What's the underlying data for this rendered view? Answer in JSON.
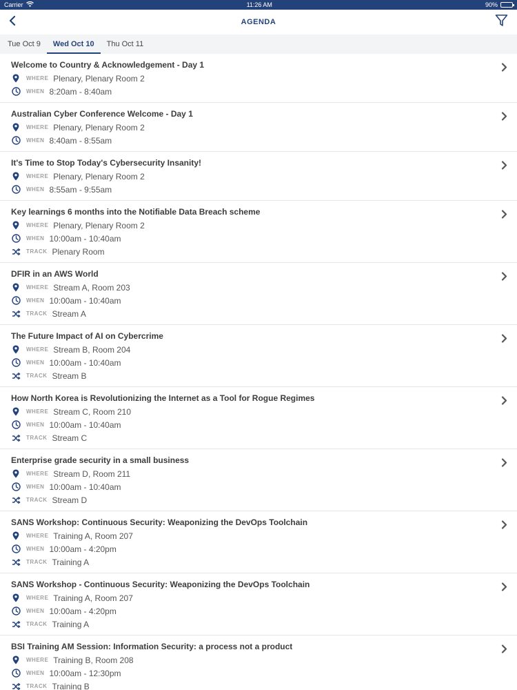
{
  "status_bar": {
    "carrier": "Carrier",
    "time": "11:26 AM",
    "battery": "90%",
    "battery_level": 0.9
  },
  "header": {
    "title": "AGENDA"
  },
  "tabs": [
    {
      "label": "Tue Oct 9",
      "active": false
    },
    {
      "label": "Wed Oct 10",
      "active": true
    },
    {
      "label": "Thu Oct 11",
      "active": false
    }
  ],
  "labels": {
    "where": "WHERE",
    "when": "WHEN",
    "track": "TRACK"
  },
  "colors": {
    "brand": "#24427a",
    "label": "#a0a0a0"
  },
  "icons": {
    "where": "map-pin-icon",
    "when": "clock-icon",
    "track": "shuffle-icon",
    "row": "chevron-right-icon"
  },
  "sessions": [
    {
      "title": "Welcome to Country & Acknowledgement - Day 1",
      "where": "Plenary, Plenary Room 2",
      "when": "8:20am - 8:40am"
    },
    {
      "title": "Australian Cyber Conference Welcome - Day 1",
      "where": "Plenary, Plenary Room 2",
      "when": "8:40am - 8:55am"
    },
    {
      "title": "It's Time to Stop Today's Cybersecurity Insanity!",
      "where": "Plenary, Plenary Room 2",
      "when": "8:55am - 9:55am"
    },
    {
      "title": "Key learnings 6 months into the Notifiable Data Breach scheme",
      "where": "Plenary, Plenary Room 2",
      "when": "10:00am - 10:40am",
      "track": "Plenary Room"
    },
    {
      "title": "DFIR in an AWS World",
      "where": "Stream A, Room 203",
      "when": "10:00am - 10:40am",
      "track": "Stream A"
    },
    {
      "title": "The Future Impact of AI on Cybercrime",
      "where": "Stream B, Room 204",
      "when": "10:00am - 10:40am",
      "track": "Stream B"
    },
    {
      "title": "How North Korea is Revolutionizing the Internet as a Tool for Rogue Regimes",
      "where": "Stream C, Room 210",
      "when": "10:00am - 10:40am",
      "track": "Stream C"
    },
    {
      "title": "Enterprise grade security in a small business",
      "where": "Stream D, Room 211",
      "when": "10:00am - 10:40am",
      "track": "Stream D"
    },
    {
      "title": "SANS Workshop: Continuous Security: Weaponizing the DevOps Toolchain",
      "where": "Training A, Room 207",
      "when": "10:00am - 4:20pm",
      "track": "Training A"
    },
    {
      "title": "SANS Workshop - Continuous Security: Weaponizing the DevOps Toolchain",
      "where": "Training A, Room 207",
      "when": "10:00am - 4:20pm",
      "track": "Training A"
    },
    {
      "title": "BSI Training AM Session: Information Security: a process not a product",
      "where": "Training B, Room 208",
      "when": "10:00am - 12:30pm",
      "track": "Training B"
    }
  ]
}
